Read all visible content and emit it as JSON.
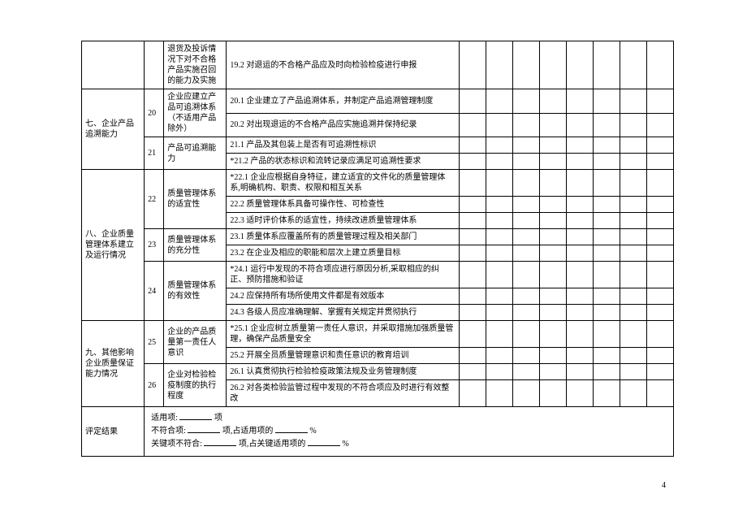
{
  "sections": {
    "prev_sub": "退货及投诉情况下对不合格产品实施召回的能力及实施",
    "prev_detail": "19.2 对退运的不合格产品应及时向检验检疫进行申报",
    "s7": {
      "title": "七、企业产品追溯能力",
      "n20": "20",
      "n20_sub": "企业应建立产品可追溯体系（不适用产品除外）",
      "n20_d1": "20.1 企业建立了产品追溯体系，并制定产品追溯管理制度",
      "n20_d2": "20.2 对出现退运的不合格产品应实施追溯并保持纪录",
      "n21": "21",
      "n21_sub": "产品可追溯能力",
      "n21_d1": "21.1 产品及其包装上是否有可追溯性标识",
      "n21_d2": "*21.2 产品的状态标识和流转记录应满足可追溯性要求"
    },
    "s8": {
      "title": "八、企业质量管理体系建立及运行情况",
      "n22": "22",
      "n22_sub": "质量管理体系的适宜性",
      "n22_d1": "*22.1 企业应根据自身特征，建立适宜的文件化的质量管理体系,明确机构、职责、权限和相互关系",
      "n22_d2": "22.2 质量管理体系具备可操作性、可检查性",
      "n22_d3": "22.3 适时评价体系的适宜性，持续改进质量管理体系",
      "n23": "23",
      "n23_sub": "质量管理体系的充分性",
      "n23_d1": "23.1 质量体系应覆盖所有的质量管理过程及相关部门",
      "n23_d2": "23.2 在企业及相应的职能和层次上建立质量目标",
      "n24": "24",
      "n24_sub": "质量管理体系的有效性",
      "n24_d1": "*24.1 运行中发现的不符合项应进行原因分析,采取相应的纠正、预防措施和验证",
      "n24_d2": "24.2 应保持所有场所使用文件都是有效版本",
      "n24_d3": "24.3 各级人员应准确理解、掌握有关规定并贯彻执行"
    },
    "s9": {
      "title": "九、其他影响企业质量保证能力情况",
      "n25": "25",
      "n25_sub": "企业的产品质量第一责任人意识",
      "n25_d1": "*25.1 企业应树立质量第一责任人意识，并采取措施加强质量管理，确保产品质量安全",
      "n25_d2": "25.2 开展全员质量管理意识和责任意识的教育培训",
      "n26": "26",
      "n26_sub": "企业对检验检疫制度的执行程度",
      "n26_d1": "26.1 认真贯彻执行检验检疫政策法规及业务管理制度",
      "n26_d2": "26.2 对各类检验监管过程中发现的不符合项应及时进行有效整改"
    }
  },
  "result": {
    "label": "评定结果",
    "line1a": "适用项:",
    "line1b": "项",
    "line2a": "不符合项:",
    "line2b": "项,占适用项的",
    "line2c": "%",
    "line3a": "关键项不符合:",
    "line3b": "项,占关键适用项的",
    "line3c": "%"
  },
  "page": "4"
}
